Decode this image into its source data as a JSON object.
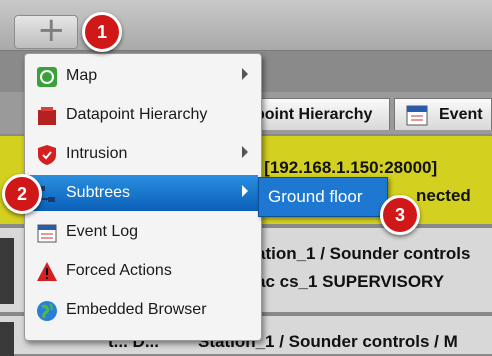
{
  "toolbar": {
    "add_label": "+"
  },
  "tabs": [
    {
      "label": "point Hierarchy"
    },
    {
      "label": "Event"
    }
  ],
  "rows": {
    "yellow_line1": "e [192.168.1.150:28000]",
    "yellow_line2": "nected",
    "grey_line1": "ation_1 / Sounder controls",
    "grey_line2": "ac cs_1    SUPERVISORY",
    "grey2_line1": "t... D...",
    "grey2_line2": "Station_1 / Sounder controls / M"
  },
  "menu": {
    "items": [
      {
        "label": "Map",
        "icon": "map-icon",
        "submenu": true
      },
      {
        "label": "Datapoint Hierarchy",
        "icon": "hierarchy-icon",
        "submenu": false
      },
      {
        "label": "Intrusion",
        "icon": "shield-icon",
        "submenu": true
      },
      {
        "label": "Subtrees",
        "icon": "subtree-icon",
        "submenu": true,
        "selected": true
      },
      {
        "label": "Event Log",
        "icon": "calendar-icon",
        "submenu": false
      },
      {
        "label": "Forced Actions",
        "icon": "warning-icon",
        "submenu": false
      },
      {
        "label": "Embedded Browser",
        "icon": "globe-icon",
        "submenu": false
      }
    ]
  },
  "submenu": {
    "item": "Ground floor"
  },
  "badges": [
    "1",
    "2",
    "3"
  ],
  "colors": {
    "selected": "#1e78d2",
    "badge": "#d11818",
    "row_yellow": "#d4d020"
  }
}
